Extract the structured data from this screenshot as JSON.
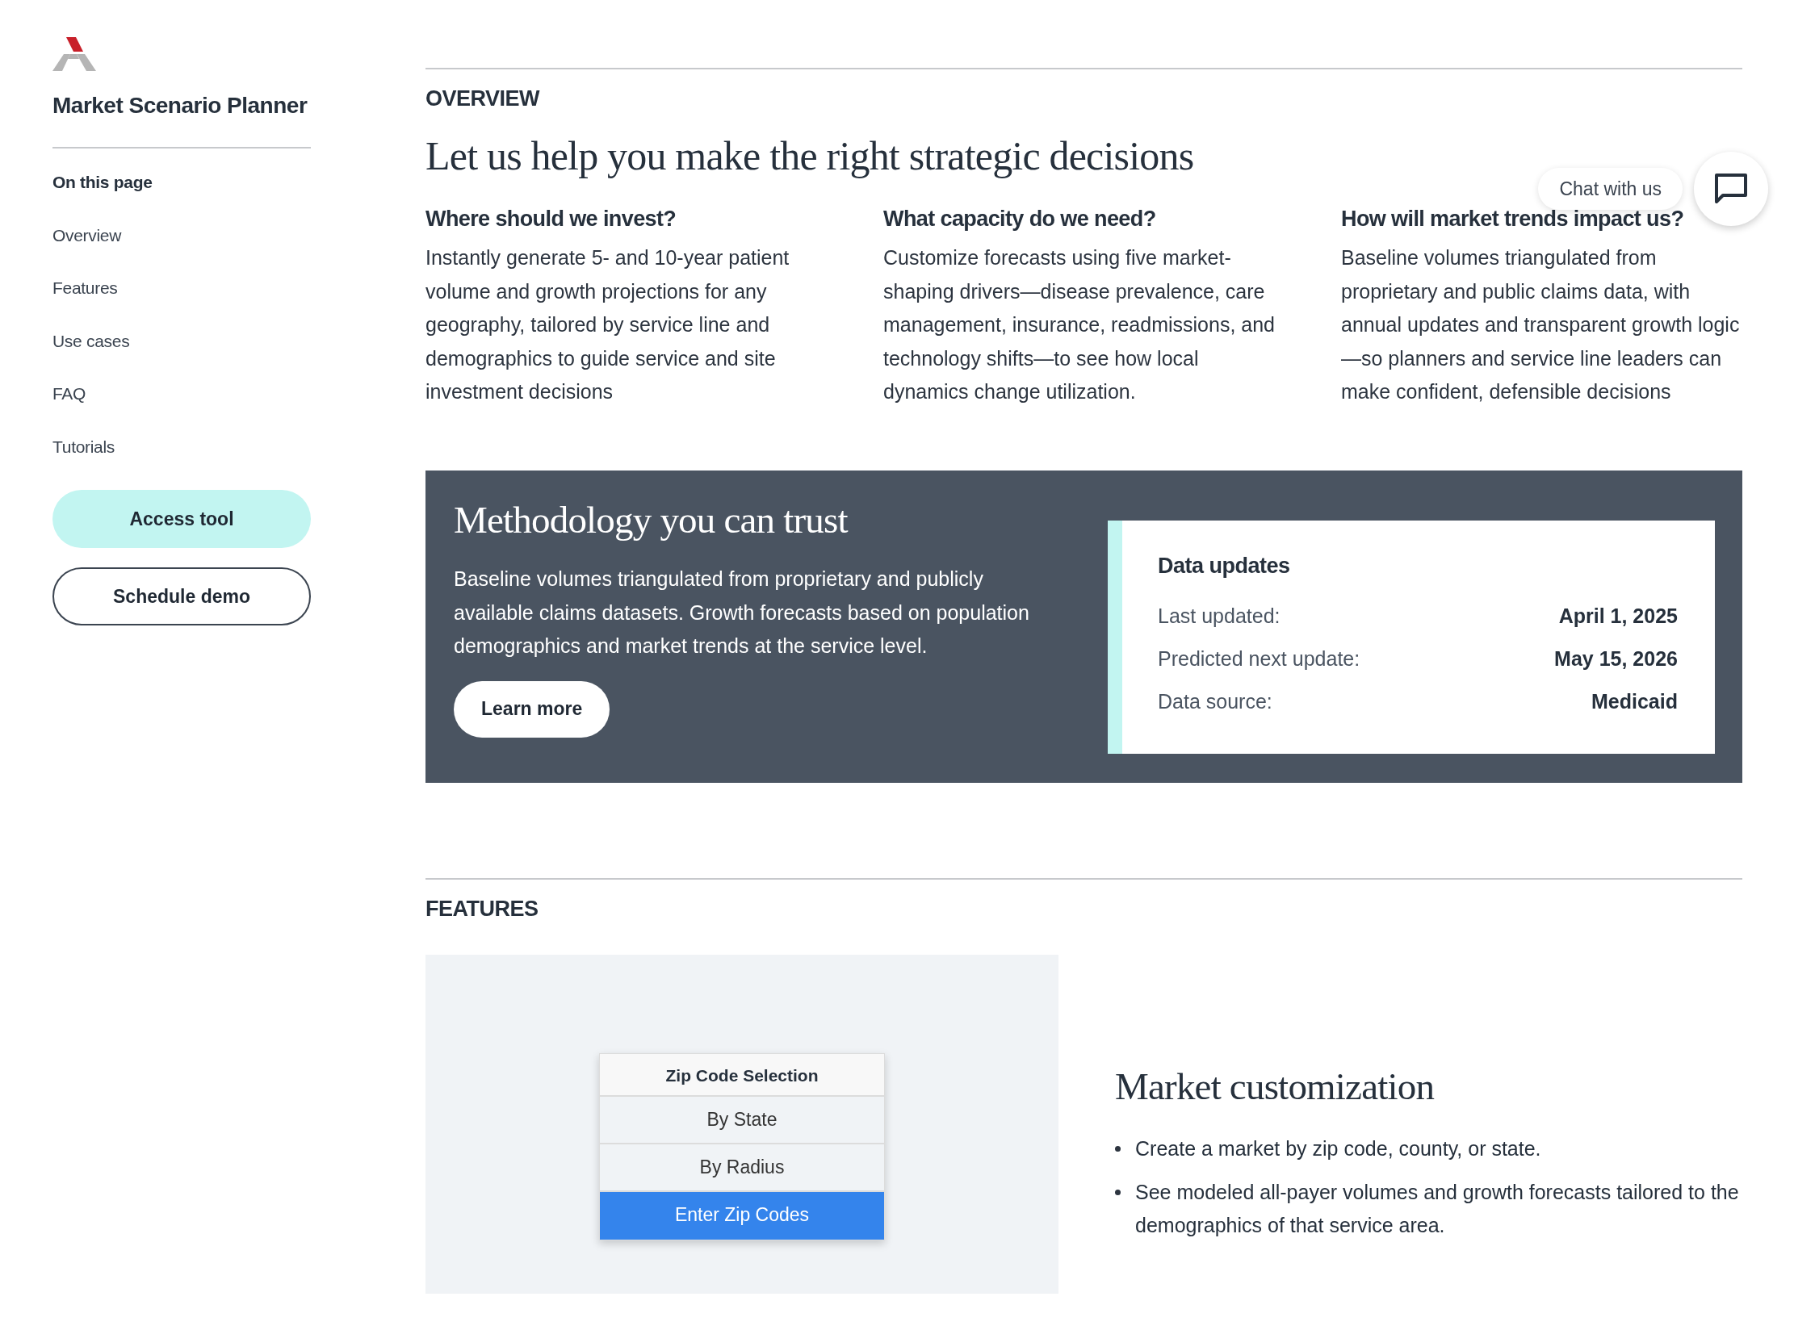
{
  "sidebar": {
    "title": "Market Scenario Planner",
    "section_label": "On this page",
    "items": [
      {
        "label": "Overview"
      },
      {
        "label": "Features"
      },
      {
        "label": "Use cases"
      },
      {
        "label": "FAQ"
      },
      {
        "label": "Tutorials"
      }
    ],
    "buttons": [
      {
        "label": "Access tool",
        "kind": "primary"
      },
      {
        "label": "Schedule demo",
        "kind": "outline"
      }
    ]
  },
  "overview": {
    "eyebrow": "OVERVIEW",
    "heading": "Let us help you make the right strategic decisions",
    "columns": [
      {
        "heading": "Where should we invest?",
        "text": "Instantly generate 5- and 10-year patient volume and growth projections for any geography, tailored by service line and demographics to guide service and site investment decisions"
      },
      {
        "heading": "What capacity do we need?",
        "text": "Customize forecasts using five market-shaping drivers—disease prevalence, care management, insurance, readmissions, and technology shifts—to see how local dynamics change utilization."
      },
      {
        "heading": "How will market trends impact us?",
        "text": "Baseline volumes triangulated from proprietary and public claims data, with annual updates and transparent growth logic—so planners and service line leaders can make confident, defensible decisions"
      }
    ]
  },
  "methodology": {
    "heading": "Methodology you can trust",
    "text": "Baseline volumes triangulated from proprietary and publicly available claims datasets. Growth forecasts based on population demographics and market trends at the service level.",
    "button": "Learn more",
    "data_updates": {
      "title": "Data updates",
      "rows": [
        {
          "label": "Last updated:",
          "value": "April 1, 2025"
        },
        {
          "label": "Predicted next update:",
          "value": "May 15, 2026"
        },
        {
          "label": "Data source:",
          "value": "Medicaid"
        }
      ]
    }
  },
  "features": {
    "eyebrow": "FEATURES",
    "widget": {
      "title": "Zip Code Selection",
      "options": [
        {
          "label": "By State",
          "selected": false
        },
        {
          "label": "By Radius",
          "selected": false
        },
        {
          "label": "Enter Zip Codes",
          "selected": true
        }
      ]
    },
    "heading": "Market customization",
    "bullets": [
      "Create a market by zip code, county, or state.",
      "See modeled all-payer volumes and growth forecasts tailored to the demographics of that service area."
    ]
  },
  "chat": {
    "label": "Chat with us"
  }
}
